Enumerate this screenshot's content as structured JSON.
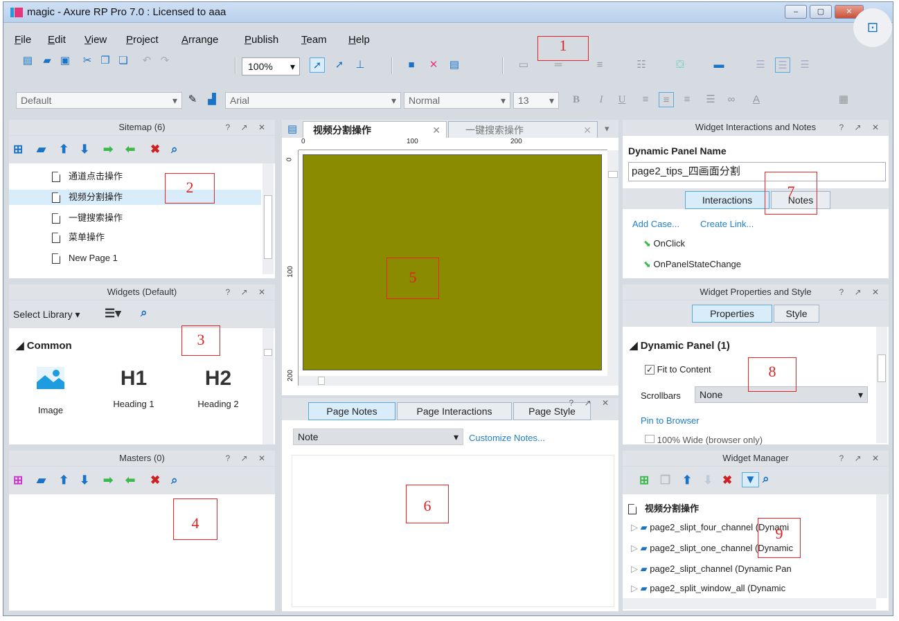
{
  "window": {
    "title": "magic - Axure RP Pro 7.0 : Licensed to aaa",
    "controls": [
      "–",
      "▢",
      "✕"
    ]
  },
  "menu": [
    "File",
    "Edit",
    "View",
    "Project",
    "Arrange",
    "Publish",
    "Team",
    "Help"
  ],
  "toolbar": {
    "zoom": "100%",
    "style_select": "Default",
    "font": "Arial",
    "weight": "Normal",
    "size": "13",
    "bold": "B",
    "italic": "I",
    "underline": "U"
  },
  "sitemap": {
    "title": "Sitemap (6)",
    "pages": [
      "通道点击操作",
      "视频分割操作",
      "一键搜索操作",
      "菜单操作",
      "New Page 1"
    ],
    "selected_index": 1
  },
  "widgets": {
    "title": "Widgets (Default)",
    "select_library": "Select Library",
    "group": "Common",
    "items": [
      {
        "icon": "image-icon",
        "glyph": "",
        "label": "Image"
      },
      {
        "icon": "heading1-icon",
        "glyph": "H1",
        "label": "Heading 1"
      },
      {
        "icon": "heading2-icon",
        "glyph": "H2",
        "label": "Heading 2"
      }
    ]
  },
  "masters": {
    "title": "Masters (0)"
  },
  "canvas": {
    "tabs": [
      "视频分割操作",
      "一键搜索操作"
    ],
    "ruler_h": [
      "0",
      "100",
      "200"
    ],
    "ruler_v": [
      "0",
      "100",
      "200"
    ],
    "panel_color": "#8b8b00"
  },
  "notes_panel": {
    "tabs": [
      "Page Notes",
      "Page Interactions",
      "Page Style"
    ],
    "note_select": "Note",
    "customize": "Customize Notes..."
  },
  "interactions": {
    "title": "Widget Interactions and Notes",
    "name_label": "Dynamic Panel Name",
    "name_value": "page2_tips_四画面分割",
    "tabs": [
      "Interactions",
      "Notes"
    ],
    "add_case": "Add Case...",
    "create_link": "Create Link...",
    "events": [
      "OnClick",
      "OnPanelStateChange"
    ]
  },
  "properties": {
    "title": "Widget Properties and Style",
    "tabs": [
      "Properties",
      "Style"
    ],
    "section": "Dynamic Panel (1)",
    "fit_to_content": "Fit to Content",
    "scrollbars_label": "Scrollbars",
    "scrollbars_value": "None",
    "pin": "Pin to Browser",
    "wide": "100% Wide (browser only)"
  },
  "widget_manager": {
    "title": "Widget Manager",
    "root": "视频分割操作",
    "items": [
      "page2_slipt_four_channel (Dynami",
      "page2_slipt_one_channel (Dynamic",
      "page2_slipt_channel (Dynamic Pan",
      "page2_split_window_all (Dynamic"
    ]
  },
  "panel_controls": "? ↗ ✕",
  "annotations": [
    "1",
    "2",
    "3",
    "4",
    "5",
    "6",
    "7",
    "8",
    "9"
  ]
}
